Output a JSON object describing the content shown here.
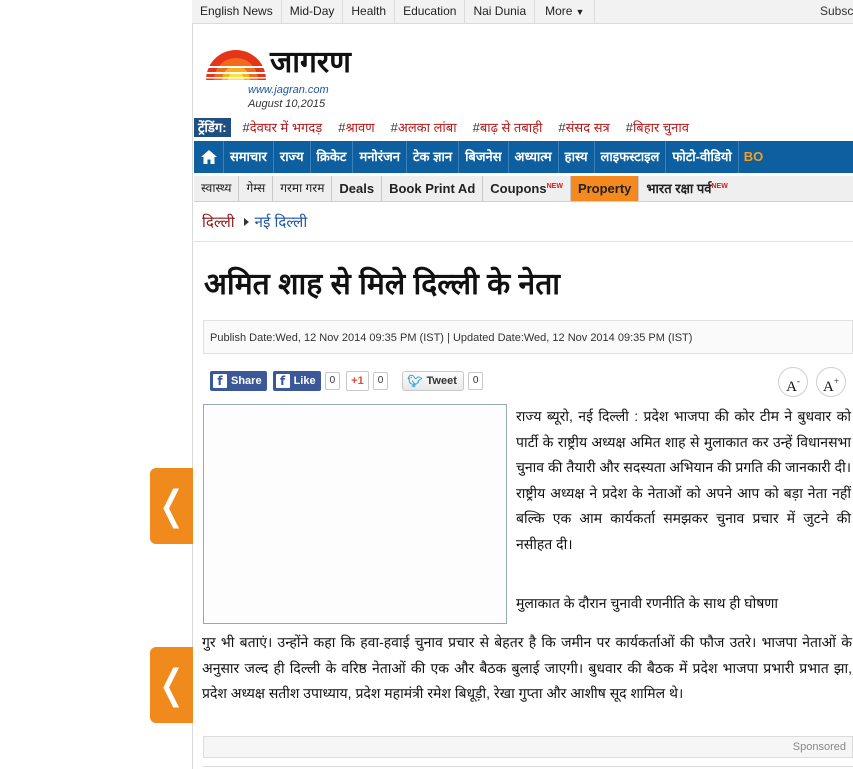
{
  "topbar": {
    "items": [
      "English News",
      "Mid-Day",
      "Health",
      "Education",
      "Nai Dunia"
    ],
    "more_label": "More",
    "subscribe_label": "Subscribe"
  },
  "logo": {
    "name": "जागरण",
    "url": "www.jagran.com",
    "date": "August 10,2015"
  },
  "trending": {
    "label": "ट्रेंडिंग:",
    "items": [
      "देवघर में भगदड़",
      "श्रावण",
      "अलका लांबा",
      "बाढ़ से तबाही",
      "संसद सत्र",
      "बिहार चुनाव"
    ]
  },
  "main_nav": {
    "items": [
      "समाचार",
      "राज्य",
      "क्रिकेट",
      "मनोरंजन",
      "टेक ज्ञान",
      "बिजनेस",
      "अध्यात्म",
      "हास्य",
      "लाइफस्टाइल",
      "फोटो-वीडियो"
    ],
    "overflow_label": "BO"
  },
  "sub_nav": {
    "items": [
      {
        "label": "स्वास्थ्य",
        "style": "normal",
        "badge": ""
      },
      {
        "label": "गेम्स",
        "style": "normal",
        "badge": ""
      },
      {
        "label": "गरमा गरम",
        "style": "normal",
        "badge": ""
      },
      {
        "label": "Deals",
        "style": "bold",
        "badge": ""
      },
      {
        "label": "Book Print Ad",
        "style": "bold",
        "badge": ""
      },
      {
        "label": "Coupons",
        "style": "bold",
        "badge": "NEW"
      },
      {
        "label": "Property",
        "style": "orange",
        "badge": ""
      },
      {
        "label": "भारत रक्षा पर्व",
        "style": "bold",
        "badge": "NEW"
      }
    ]
  },
  "breadcrumb": {
    "section": "दिल्ली",
    "subsection": "नई दिल्ली"
  },
  "article": {
    "title": "अमित शाह से मिले दिल्ली के नेता",
    "dates": "Publish Date:Wed, 12 Nov 2014 09:35 PM (IST) | Updated Date:Wed, 12 Nov 2014 09:35 PM (IST)",
    "paragraph1": "राज्य ब्यूरो, नई दिल्ली : प्रदेश भाजपा की कोर टीम ने बुधवार को पार्टी के राष्ट्रीय अध्यक्ष अमित शाह से मुलाकात कर उन्हें विधानसभा चुनाव की तैयारी और सदस्यता अभियान की प्रगति की जानकारी दी। राष्ट्रीय अध्यक्ष ने प्रदेश के नेताओं को अपने आप को बड़ा नेता नहीं बल्कि एक आम कार्यकर्ता समझकर चुनाव प्रचार में जुटने की नसीहत दी।",
    "paragraph2_start": "मुलाकात के दौरान चुनावी रणनीति के साथ ही घोषणा",
    "paragraph2_rest": "गुर भी बताएं। उन्होंने कहा कि हवा-हवाई चुनाव प्रचार से बेहतर है कि जमीन पर कार्यकर्ताओं की फौज उतरे। भाजपा नेताओं के अनुसार जल्द ही दिल्ली के वरिष्ठ नेताओं की एक और बैठक बुलाई जाएगी। बुधवार की बैठक में प्रदेश भाजपा प्रभारी प्रभात झा, प्रदेश अध्यक्ष सतीश उपाध्याय, प्रदेश महामंत्री रमेश बिधूड़ी, रेखा गुप्ता और आशीष सूद शामिल थे।"
  },
  "share": {
    "fb_share_label": "Share",
    "fb_like_label": "Like",
    "fb_like_count": "0",
    "gplus_label": "+1",
    "gplus_count": "0",
    "tweet_label": "Tweet",
    "tweet_count": "0",
    "font_decrease_label": "A",
    "font_increase_label": "A"
  },
  "sponsored_label": "Sponsored",
  "colors": {
    "nav_blue": "#0d5fa0",
    "accent_orange": "#f08a1c",
    "trending_red": "#b21c1c",
    "link_blue": "#1f56a5"
  }
}
